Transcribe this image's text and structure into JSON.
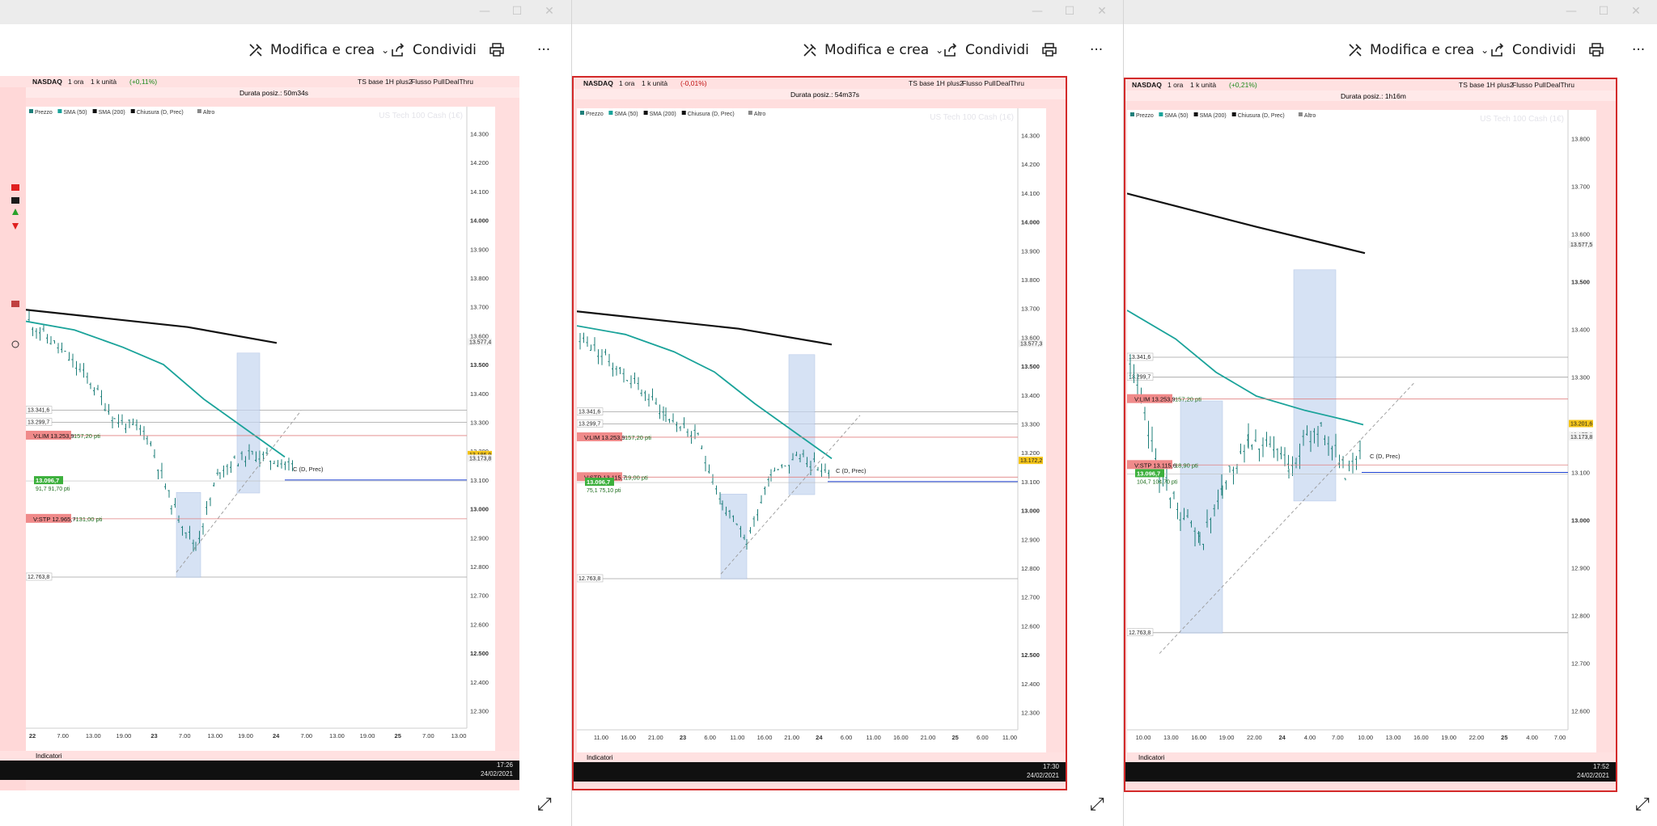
{
  "commands": {
    "edit_label": "Modifica e crea",
    "share_label": "Condividi",
    "print_label": "",
    "more_label": "···"
  },
  "caption": {
    "minimize": "—",
    "maximize": "☐",
    "close": "✕"
  },
  "windows": [
    {
      "symbol": "NASDAQ",
      "timeframe": "1 ora",
      "units": "1 k unità",
      "change": "(+0,11%)",
      "strategy_tabs": [
        "TS base 1H plus2",
        "Flusso Pull",
        "DealThru"
      ],
      "legend": [
        "Prezzo",
        "SMA (50)",
        "SMA (200)",
        "Chiusura (D, Prec)",
        "Altro"
      ],
      "duration": "Durata posiz.: 50m34s",
      "watermark": "US Tech 100 Cash (1€)",
      "y_ticks": [
        "14.300",
        "14.200",
        "14.100",
        "14.000",
        "13.900",
        "13.800",
        "13.700",
        "13.600",
        "13.500",
        "13.400",
        "13.300",
        "13.200",
        "13.100",
        "13.000",
        "12.900",
        "12.800",
        "12.700",
        "12.600",
        "12.500",
        "12.400",
        "12.300"
      ],
      "x_ticks": [
        "22",
        "7.00",
        "13.00",
        "19.00",
        "23",
        "7.00",
        "13.00",
        "19.00",
        "24",
        "7.00",
        "13.00",
        "19.00",
        "25",
        "7.00",
        "13.00"
      ],
      "level_labels": [
        "13.341,6",
        "13.299,7",
        "12.763,8"
      ],
      "order_vlim": "V:LIM  13.253,9",
      "order_vlim_pts": "157,20 pti",
      "position": "13.096,7",
      "position_pts": "91,7  91,70 pti",
      "order_vstp": "V:STP  12.965,7",
      "order_vstp_pts": "-131,00 pti",
      "price_tags": [
        "13.577,4",
        "13.186,9",
        "13.173,8"
      ],
      "close_label": "C (D, Prec)",
      "toolbar_label": "Indicatori",
      "clock": "17:26",
      "date": "24/02/2021"
    },
    {
      "symbol": "NASDAQ",
      "timeframe": "1 ora",
      "units": "1 k unità",
      "change": "(-0,01%)",
      "strategy_tabs": [
        "TS base 1H plus2",
        "Flusso Pull",
        "DealThru"
      ],
      "legend": [
        "Prezzo",
        "SMA (50)",
        "SMA (200)",
        "Chiusura (D, Prec)",
        "Altro"
      ],
      "duration": "Durata posiz.: 54m37s",
      "watermark": "US Tech 100 Cash (1€)",
      "y_ticks": [
        "14.300",
        "14.200",
        "14.100",
        "14.000",
        "13.900",
        "13.800",
        "13.700",
        "13.600",
        "13.500",
        "13.400",
        "13.300",
        "13.200",
        "13.100",
        "13.000",
        "12.900",
        "12.800",
        "12.700",
        "12.600",
        "12.500",
        "12.400",
        "12.300"
      ],
      "x_ticks": [
        "11.00",
        "16.00",
        "21.00",
        "23",
        "6.00",
        "11.00",
        "16.00",
        "21.00",
        "24",
        "6.00",
        "11.00",
        "16.00",
        "21.00",
        "25",
        "6.00",
        "11.00"
      ],
      "level_labels": [
        "13.341,6",
        "13.299,7",
        "12.763,8"
      ],
      "order_vlim": "V:LIM  13.253,9",
      "order_vlim_pts": "157,20 pti",
      "order_vstp": "V:STP  13.115,7",
      "order_vstp_pts": "19,00 pti",
      "position": "13.096,7",
      "position_pts": "75,1  75,10 pti",
      "price_tags": [
        "13.577,3",
        "13.172,2"
      ],
      "close_label": "C (D, Prec)",
      "toolbar_label": "Indicatori",
      "clock": "17:30",
      "date": "24/02/2021"
    },
    {
      "symbol": "NASDAQ",
      "timeframe": "1 ora",
      "units": "1 k unità",
      "change": "(+0,21%)",
      "strategy_tabs": [
        "TS base 1H plus2",
        "Flusso Pull",
        "DealThru"
      ],
      "legend": [
        "Prezzo",
        "SMA (50)",
        "SMA (200)",
        "Chiusura (D, Prec)",
        "Altro"
      ],
      "duration": "Durata posiz.: 1h16m",
      "watermark": "US Tech 100 Cash (1€)",
      "y_ticks": [
        "13.800",
        "13.700",
        "13.600",
        "13.500",
        "13.400",
        "13.300",
        "13.200",
        "13.100",
        "13.000",
        "12.900",
        "12.800",
        "12.700",
        "12.600"
      ],
      "x_ticks": [
        "10.00",
        "13.00",
        "16.00",
        "19.00",
        "22.00",
        "24",
        "4.00",
        "7.00",
        "10.00",
        "13.00",
        "16.00",
        "19.00",
        "22.00",
        "25",
        "4.00",
        "7.00"
      ],
      "level_labels": [
        "13.341,6",
        "13.299,7",
        "12.763,8"
      ],
      "order_vlim": "V:LIM  13.253,9",
      "order_vlim_pts": "157,20 pti",
      "order_vstp": "V:STP  13.115,6",
      "order_vstp_pts": "18,90 pti",
      "position": "13.096,7",
      "position_pts": "104,7  104,70 pti",
      "price_tags": [
        "13.577,5",
        "13.201,6",
        "13.177,6",
        "13.173,8"
      ],
      "close_label": "C (D, Prec)",
      "toolbar_label": "Indicatori",
      "clock": "17:52",
      "date": "24/02/2021"
    }
  ],
  "colors": {
    "accent_red": "#d32a2a",
    "sma50": "#1aa39a",
    "sma200": "#111111",
    "candles": "#1e7f7a",
    "blue_zone": "#c6d6f0",
    "close_line": "#1a3fd0"
  }
}
